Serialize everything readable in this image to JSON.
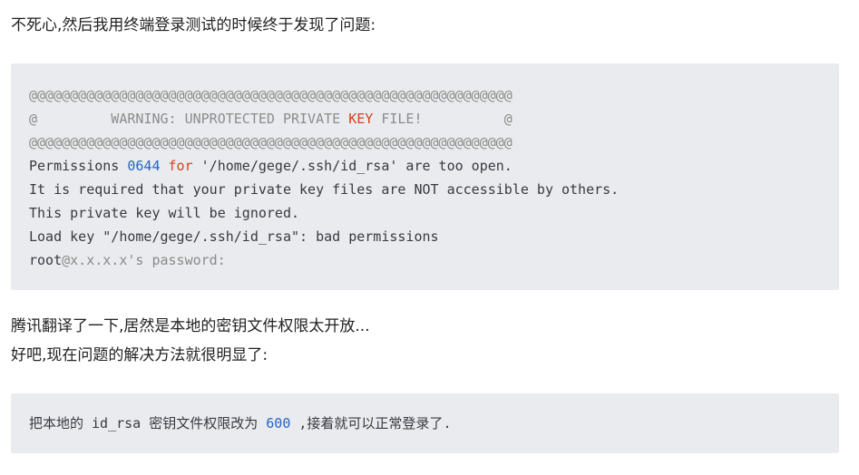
{
  "intro": "不死心,然后我用终端登录测试的时候终于发现了问题:",
  "code1": {
    "border_line_1": "@@@@@@@@@@@@@@@@@@@@@@@@@@@@@@@@@@@@@@@@@@@@@@@@@@@@@@@@@@@",
    "warn_prefix": "@         WARNING: UNPROTECTED PRIVATE ",
    "warn_keyword": "KEY",
    "warn_suffix": " FILE!          @",
    "border_line_2": "@@@@@@@@@@@@@@@@@@@@@@@@@@@@@@@@@@@@@@@@@@@@@@@@@@@@@@@@@@@",
    "perm_prefix": "Permissions ",
    "perm_number": "0644",
    "perm_space": " ",
    "perm_keyword": "for",
    "perm_suffix": " '/home/gege/.ssh/id_rsa' are too open.",
    "line_required": "It is required that your private key files are NOT accessible by others.",
    "line_ignored": "This private key will be ignored.",
    "line_load": "Load key \"/home/gege/.ssh/id_rsa\": bad permissions",
    "prompt_user": "root",
    "prompt_rest": "@x.x.x.x's password:"
  },
  "para2_line1": "腾讯翻译了一下,居然是本地的密钥文件权限太开放...",
  "para2_line2": "好吧,现在问题的解决方法就很明显了:",
  "code2": {
    "prefix": "把本地的 id_rsa 密钥文件权限改为 ",
    "number": "600",
    "suffix": " ,接着就可以正常登录了."
  },
  "colors": {
    "code_background": "#e9ebee",
    "keyword": "#d4441c",
    "number": "#2664c4",
    "comment": "#8c8c8c"
  }
}
